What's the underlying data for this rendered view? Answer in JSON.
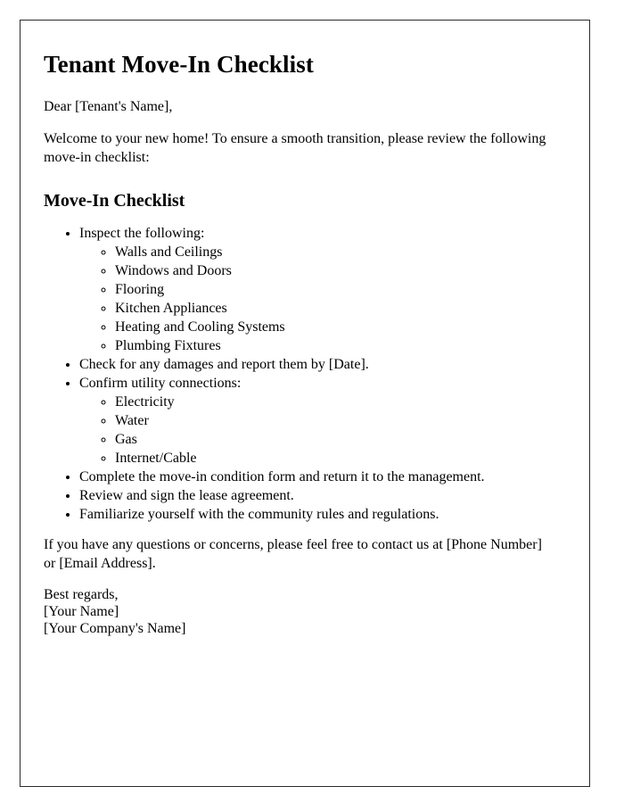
{
  "document": {
    "title": "Tenant Move-In Checklist",
    "salutation": "Dear [Tenant's Name],",
    "intro_paragraph": "Welcome to your new home! To ensure a smooth transition, please review the following move-in checklist:",
    "section_heading": "Move-In Checklist",
    "checklist": [
      {
        "text": "Inspect the following:",
        "subitems": [
          "Walls and Ceilings",
          "Windows and Doors",
          "Flooring",
          "Kitchen Appliances",
          "Heating and Cooling Systems",
          "Plumbing Fixtures"
        ]
      },
      {
        "text": "Check for any damages and report them by [Date].",
        "subitems": []
      },
      {
        "text": "Confirm utility connections:",
        "subitems": [
          "Electricity",
          "Water",
          "Gas",
          "Internet/Cable"
        ]
      },
      {
        "text": "Complete the move-in condition form and return it to the management.",
        "subitems": []
      },
      {
        "text": "Review and sign the lease agreement.",
        "subitems": []
      },
      {
        "text": "Familiarize yourself with the community rules and regulations.",
        "subitems": []
      }
    ],
    "contact_paragraph": "If you have any questions or concerns, please feel free to contact us at [Phone Number] or [Email Address].",
    "signature": {
      "closing": "Best regards,",
      "name": "[Your Name]",
      "company": "[Your Company's Name]"
    }
  }
}
